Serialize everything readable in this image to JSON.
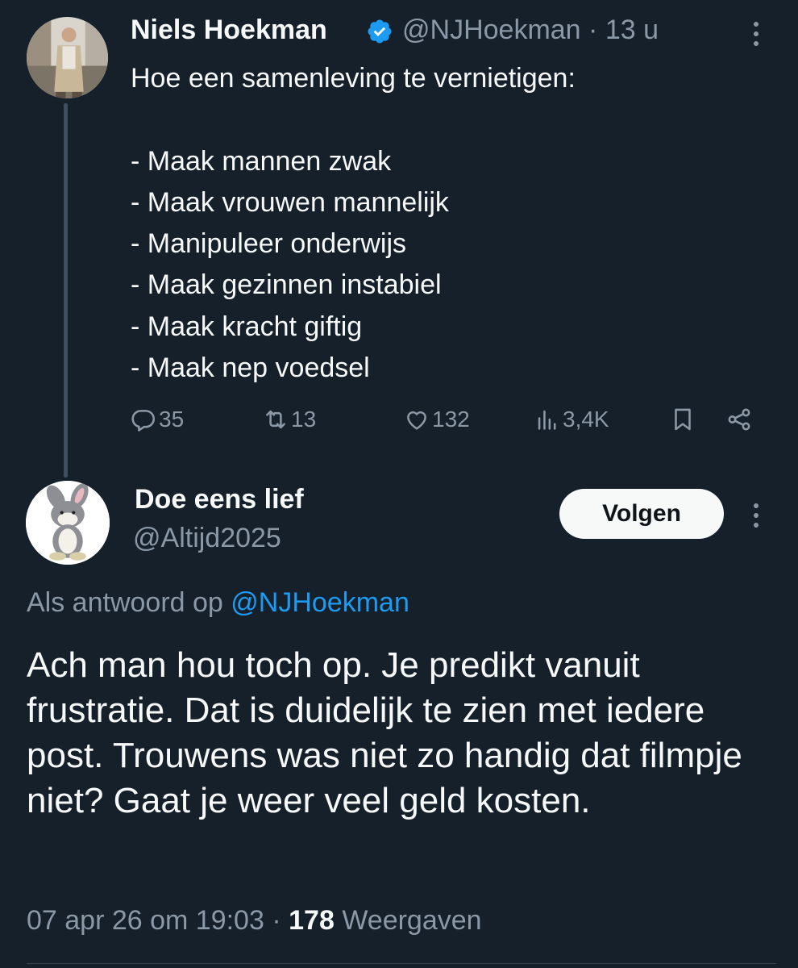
{
  "tweet": {
    "author_name": "Niels Hoekman",
    "handle": "@NJHoekman",
    "separator": "·",
    "time": "13 u",
    "body": "Hoe een samenleving te vernietigen:\n\n- Maak mannen zwak\n- Maak vrouwen mannelijk\n- Manipuleer onderwijs\n- Maak gezinnen instabiel\n- Maak kracht giftig\n- Maak nep voedsel",
    "actions": {
      "replies": "35",
      "reposts": "13",
      "likes": "132",
      "views": "3,4K"
    }
  },
  "reply": {
    "author_name": "Doe eens lief",
    "handle": "@Altijd2025",
    "follow_label": "Volgen",
    "reply_to_prefix": "Als antwoord op",
    "reply_to_handle": "@NJHoekman",
    "body": "Ach man hou toch op. Je  predikt vanuit frustratie. Dat is duidelijk te zien met iedere post. Trouwens was niet zo handig dat filmpje niet? Gaat je weer veel geld kosten.",
    "timestamp": "07 apr 26 om 19:03",
    "separator": "·",
    "view_count": "178",
    "view_label": "Weergaven"
  },
  "colors": {
    "background": "#15202b",
    "text": "#f7f9f9",
    "muted": "#8b98a5",
    "link": "#1d9bf0",
    "verified": "#1d9bf0"
  },
  "icons": [
    "verified-badge-icon",
    "more-icon",
    "reply-icon",
    "repost-icon",
    "like-icon",
    "views-icon",
    "bookmark-icon",
    "share-icon"
  ]
}
